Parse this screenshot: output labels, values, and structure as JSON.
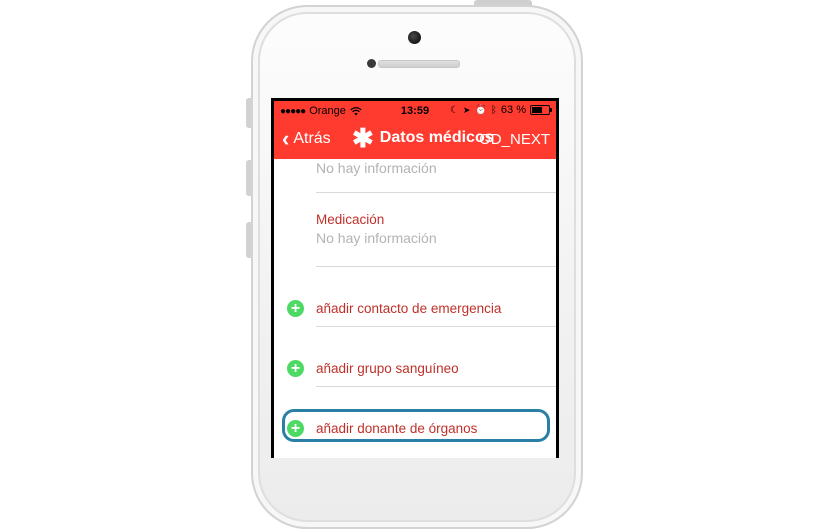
{
  "statusbar": {
    "carrier": "Orange",
    "time": "13:59",
    "battery": "63 %",
    "battery_level": 0.63
  },
  "navbar": {
    "back_label": "Atrás",
    "title": "Datos médicos",
    "right_label": "OD_NEXT"
  },
  "fields": [
    {
      "label": "",
      "value": "No hay información"
    },
    {
      "label": "Medicación",
      "value": "No hay información"
    }
  ],
  "add_rows": [
    {
      "label": "añadir contacto de emergencia"
    },
    {
      "label": "añadir grupo sanguíneo"
    },
    {
      "label": "añadir donante de órganos"
    }
  ],
  "colors": {
    "accent_red": "#ff3b30",
    "label_red": "#c0302a",
    "add_green": "#4cd964",
    "highlight_blue": "#2a7fa6"
  }
}
